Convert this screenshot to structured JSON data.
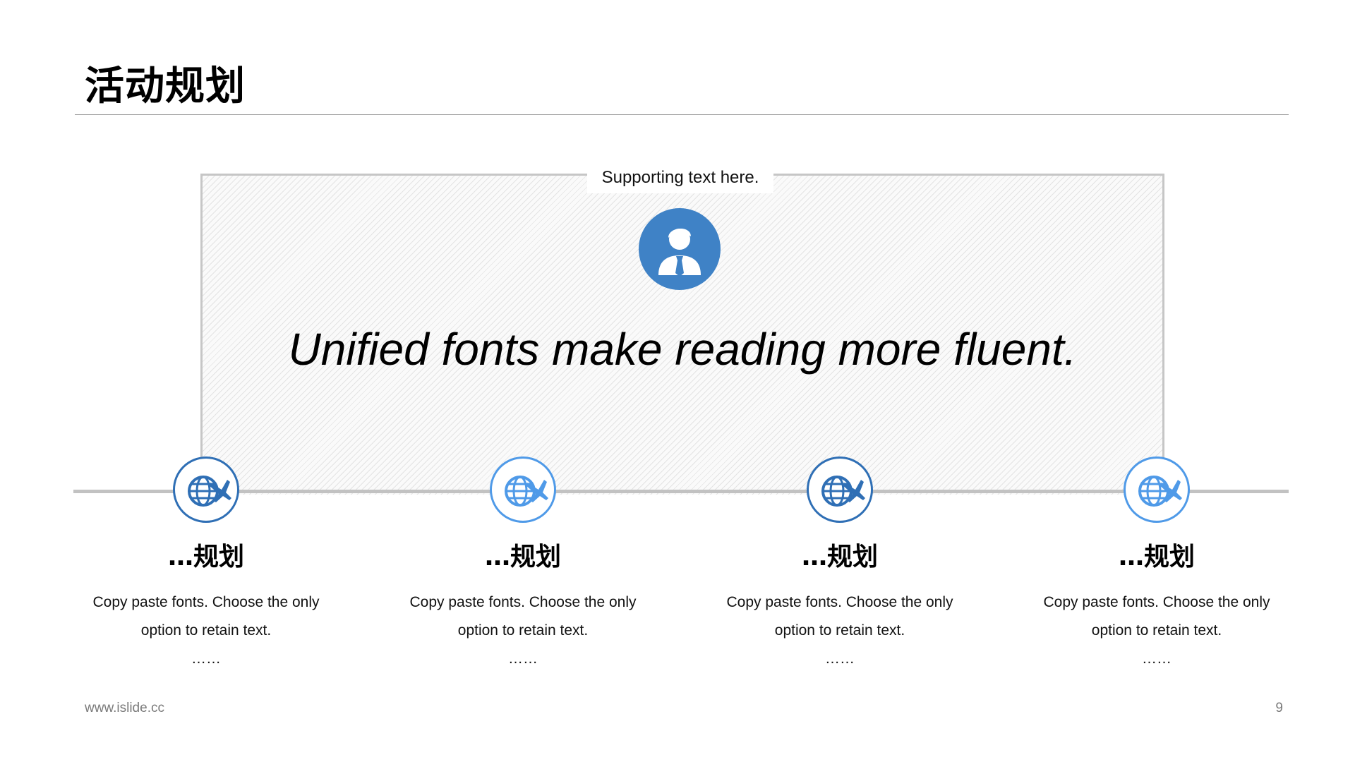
{
  "slide": {
    "title": "活动规划",
    "supporting_text": "Supporting text here.",
    "tagline": "Unified fonts make reading more fluent.",
    "footer_url": "www.islide.cc",
    "page_number": "9"
  },
  "icons": {
    "header": "businessman-icon",
    "nodes": "globe-plane-icon"
  },
  "colors": {
    "accent_dark": "#2f6fb5",
    "accent_light": "#4f9ae8",
    "avatar_fill": "#3f82c6"
  },
  "steps": [
    {
      "title": "…规划",
      "line1": "Copy paste fonts. Choose the only",
      "line2": "option to retain text.",
      "line3": "……"
    },
    {
      "title": "…规划",
      "line1": "Copy paste fonts. Choose the only",
      "line2": "option to retain text.",
      "line3": "……"
    },
    {
      "title": "…规划",
      "line1": "Copy paste fonts. Choose the only",
      "line2": "option to retain text.",
      "line3": "……"
    },
    {
      "title": "…规划",
      "line1": "Copy paste fonts. Choose the only",
      "line2": "option to retain text.",
      "line3": "……"
    }
  ]
}
